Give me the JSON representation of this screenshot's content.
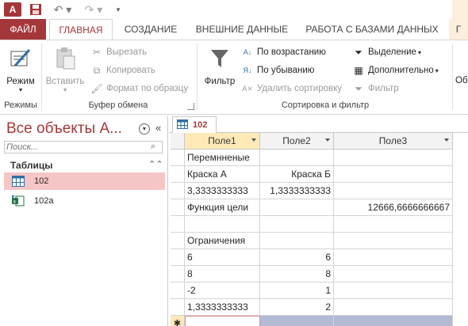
{
  "quick_access": {
    "app_logo": "A",
    "icons": [
      "access-logo-icon",
      "save-icon",
      "undo-icon",
      "redo-icon",
      "customize-qat-icon"
    ]
  },
  "tabs": [
    {
      "label": "ФАЙЛ"
    },
    {
      "label": "ГЛАВНАЯ"
    },
    {
      "label": "СОЗДАНИЕ"
    },
    {
      "label": "ВНЕШНИЕ ДАННЫЕ"
    },
    {
      "label": "РАБОТА С БАЗАМИ ДАННЫХ"
    },
    {
      "label": "Г"
    }
  ],
  "ribbon": {
    "groups": {
      "modes": {
        "label": "Режимы",
        "mode_button": "Режим"
      },
      "clipboard": {
        "label": "Буфер обмена",
        "paste": "Вставить",
        "cut": "Вырезать",
        "copy": "Копировать",
        "format_painter": "Формат по образцу"
      },
      "sort_filter": {
        "label": "Сортировка и фильтр",
        "filter": "Фильтр",
        "ascending": "По возрастанию",
        "descending": "По убыванию",
        "remove_sort": "Удалить сортировку",
        "selection": "Выделение",
        "advanced": "Дополнительно",
        "toggle_filter": "Фильтр"
      },
      "cut_off": "Об"
    }
  },
  "nav": {
    "title": "Все объекты А...",
    "search_placeholder": "Поиск...",
    "group_label": "Таблицы",
    "items": [
      {
        "label": "102",
        "icon": "table-icon",
        "selected": true
      },
      {
        "label": "102a",
        "icon": "excel-linked-table-icon",
        "selected": false
      }
    ]
  },
  "document": {
    "tab_label": "102",
    "columns": [
      "Поле1",
      "Поле2",
      "Поле3"
    ],
    "rows": [
      [
        "Перемнненые",
        "",
        ""
      ],
      [
        "Краска А",
        "Краска Б",
        ""
      ],
      [
        "3,3333333333",
        "1,3333333333",
        ""
      ],
      [
        "Функция цели",
        "",
        "12666,6666666667"
      ],
      [
        "",
        "",
        ""
      ],
      [
        "Ограничения",
        "",
        ""
      ],
      [
        "6",
        "6",
        ""
      ],
      [
        "8",
        "8",
        ""
      ],
      [
        "-2",
        "1",
        ""
      ],
      [
        "1,3333333333",
        "2",
        ""
      ]
    ],
    "new_record_marker": "✱"
  },
  "colors": {
    "accent": "#a4373a",
    "selected_nav": "#f6c5c5",
    "active_header": "#ffe9b7",
    "new_row": "#b3bbd4"
  }
}
